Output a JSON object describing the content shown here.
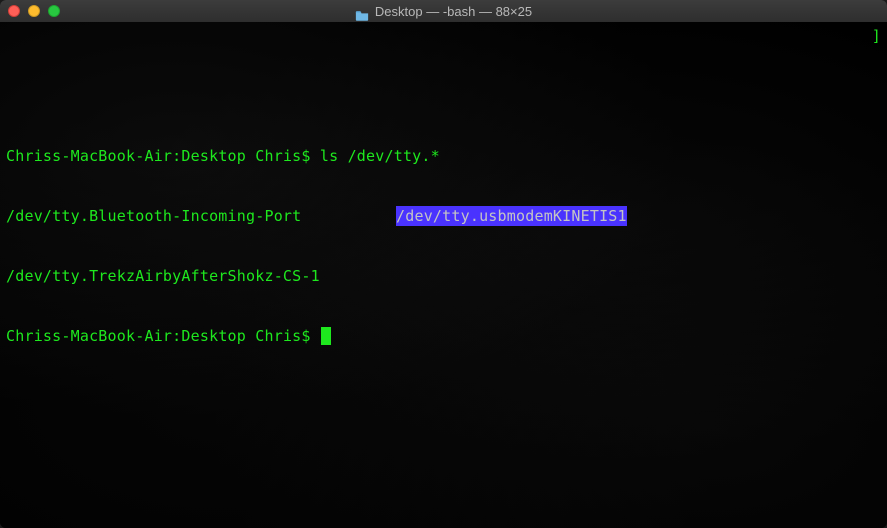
{
  "titlebar": {
    "folder_label": "Desktop",
    "title": "Desktop — -bash — 88×25"
  },
  "terminal": {
    "prompt_host": "Chriss-MacBook-Air",
    "prompt_cwd": "Desktop",
    "prompt_user": "Chris",
    "prompt_sep1": ":",
    "prompt_sep2": "$",
    "cmd1": "ls /dev/tty.*",
    "output": {
      "col1": "/dev/tty.Bluetooth-Incoming-Port",
      "col2_selected": "/dev/tty.usbmodemKINETIS1",
      "line2": "/dev/tty.TrekzAirbyAfterShokz-CS-1"
    },
    "right_edge_char": "]"
  }
}
